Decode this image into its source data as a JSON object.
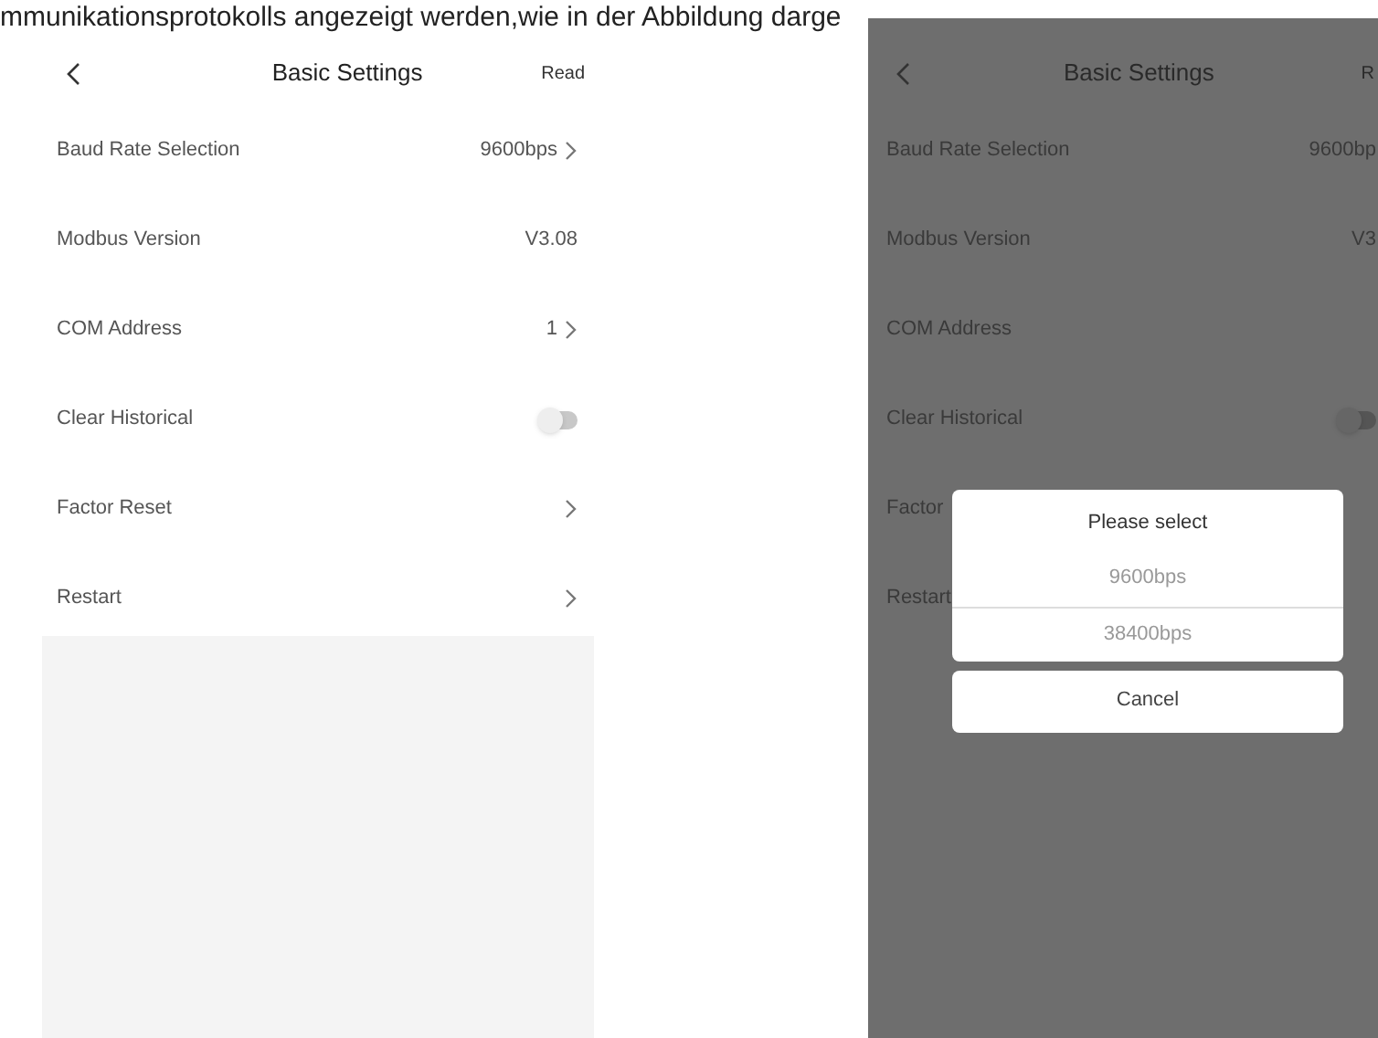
{
  "caption": "mmunikationsprotokolls angezeigt werden,wie in der Abbildung darge",
  "left_screen": {
    "title": "Basic Settings",
    "action": "Read",
    "rows": [
      {
        "kind": "value",
        "label": "Baud Rate Selection",
        "value": "9600bps",
        "chevron": true
      },
      {
        "kind": "value",
        "label": "Modbus Version",
        "value": "V3.08",
        "chevron": false
      },
      {
        "kind": "value",
        "label": "COM Address",
        "value": "1",
        "chevron": true
      },
      {
        "kind": "toggle",
        "label": "Clear Historical",
        "on": false
      },
      {
        "kind": "value",
        "label": "Factor Reset",
        "chevron": true
      },
      {
        "kind": "value",
        "label": "Restart",
        "chevron": true
      }
    ]
  },
  "right_screen": {
    "title": "Basic Settings",
    "action": "R",
    "rows": [
      {
        "kind": "value",
        "label": "Baud Rate Selection",
        "value": "9600bp"
      },
      {
        "kind": "value",
        "label": "Modbus Version",
        "value": "V3"
      },
      {
        "kind": "value",
        "label": "COM Address"
      },
      {
        "kind": "toggle",
        "label": "Clear Historical",
        "on": false
      },
      {
        "kind": "value",
        "label": "Factor"
      },
      {
        "kind": "value",
        "label": "Restart"
      }
    ],
    "dialog": {
      "title": "Please select",
      "options": [
        "9600bps",
        "38400bps"
      ],
      "cancel": "Cancel"
    }
  }
}
